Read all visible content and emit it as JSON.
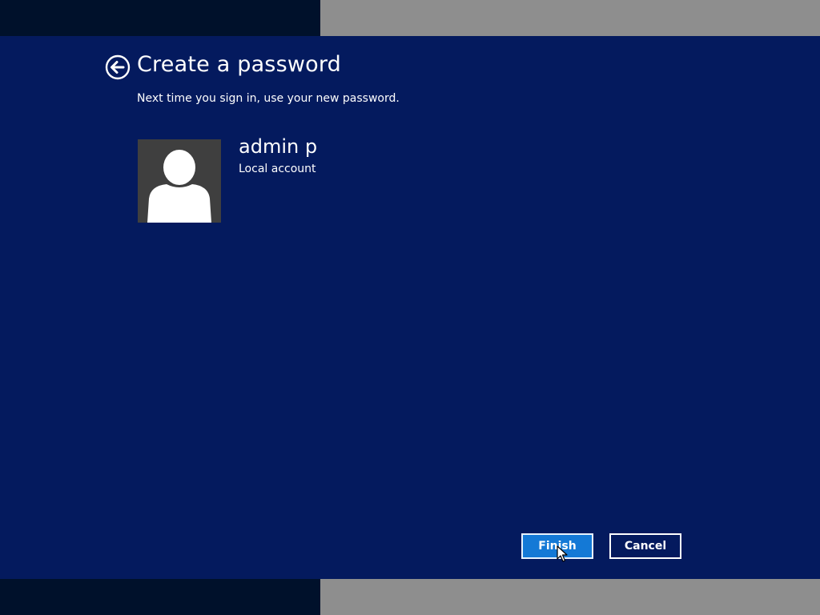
{
  "header": {
    "title": "Create a password",
    "subtitle": "Next time you sign in, use your new password.",
    "back_icon": "back-arrow-circle-icon"
  },
  "user": {
    "name": "admin p",
    "account_type": "Local account",
    "avatar_icon": "user-silhouette-icon"
  },
  "buttons": {
    "finish_label": "Finish",
    "cancel_label": "Cancel"
  },
  "colors": {
    "background": "#041a5e",
    "accent": "#1479d6",
    "avatar_bg": "#3f3f3f"
  }
}
